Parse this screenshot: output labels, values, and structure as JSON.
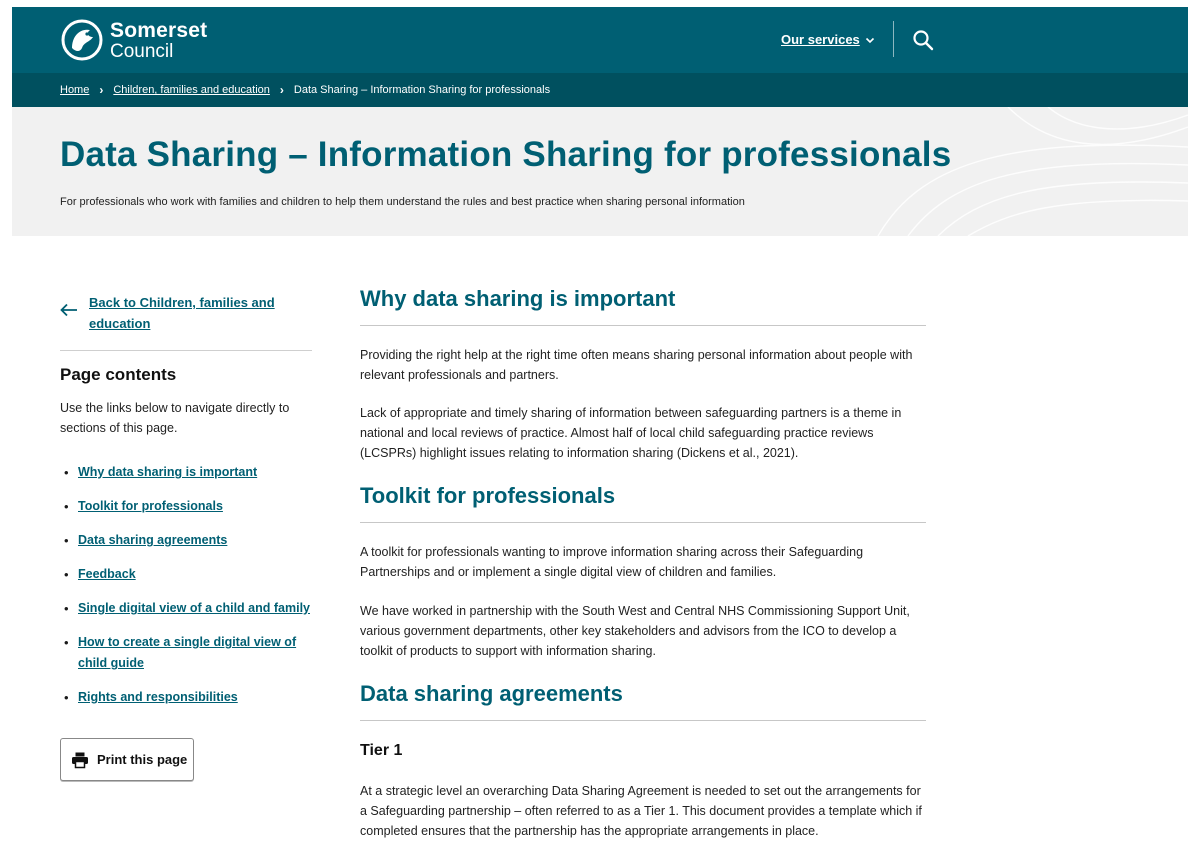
{
  "header": {
    "logo_line1": "Somerset",
    "logo_line2": "Council",
    "services_label": "Our services",
    "brand_color": "#005f73"
  },
  "breadcrumb": {
    "items": [
      "Home",
      "Children, families and education"
    ],
    "current": "Data Sharing – Information Sharing for professionals"
  },
  "hero": {
    "title": "Data Sharing – Information Sharing for professionals",
    "subtitle": "For professionals who work with families and children to help them understand the rules and best practice when sharing personal information"
  },
  "sidebar": {
    "back_link": "Back to Children, families and education",
    "contents_title": "Page contents",
    "contents_desc": "Use the links below to navigate directly to sections of this page.",
    "links": [
      "Why data sharing is important",
      "Toolkit for professionals",
      "Data sharing agreements",
      "Feedback",
      "Single digital view of a child and family",
      "How to create a single digital view of child guide",
      "Rights and responsibilities"
    ],
    "print_label": "Print this page"
  },
  "main": {
    "section1": {
      "heading": "Why data sharing is important",
      "p1": "Providing the right help at the right time often means sharing personal information about people with relevant professionals and partners.",
      "p2": "Lack of appropriate and timely sharing of information between safeguarding partners is a theme in national and local reviews of practice. Almost half of local child safeguarding practice reviews (LCSPRs) highlight issues relating to information sharing (Dickens et al., 2021)."
    },
    "section2": {
      "heading": "Toolkit for professionals",
      "p1": "A toolkit for professionals wanting to improve information sharing across their Safeguarding Partnerships and or implement a single digital view of children and families.",
      "p2": "We have worked in partnership with the South West and Central NHS Commissioning Support Unit, various government departments, other key stakeholders and advisors from the ICO to develop a toolkit of products to support with information sharing."
    },
    "section3": {
      "heading": "Data sharing agreements",
      "subheading": "Tier 1",
      "p1": "At a strategic level an overarching Data Sharing Agreement is needed to set out the arrangements for a Safeguarding partnership – often referred to as a Tier 1. This document provides a template which if completed ensures that the partnership has the appropriate arrangements in place."
    }
  }
}
